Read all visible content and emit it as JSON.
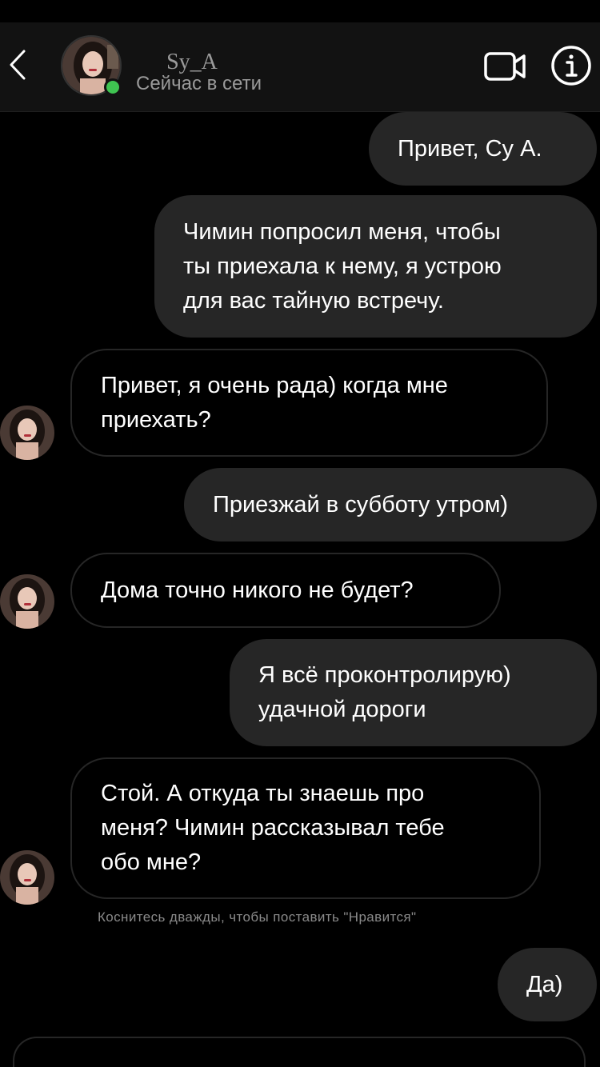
{
  "header": {
    "name": "Sy_A",
    "status": "Сейчас в сети",
    "back_icon": "chevron-left-icon",
    "video_icon": "video-camera-icon",
    "info_icon": "info-icon",
    "online_color": "#3fc451"
  },
  "messages": [
    {
      "from": "me",
      "text": "Привет, Су А."
    },
    {
      "from": "me",
      "text": "Чимин попросил меня, чтобы\nты приехала к нему, я устрою\nдля вас тайную встречу."
    },
    {
      "from": "them",
      "text": "Привет, я очень рада) когда мне\nприехать?"
    },
    {
      "from": "me",
      "text": "Приезжай в субботу утром)"
    },
    {
      "from": "them",
      "text": "Дома точно никого не будет?"
    },
    {
      "from": "me",
      "text": "Я всё проконтролирую)\nудачной дороги"
    },
    {
      "from": "them",
      "text": "Стой. А откуда ты знаешь про\nменя? Чимин рассказывал тебе\nобо мне?"
    },
    {
      "from": "me",
      "text": "Да)"
    }
  ],
  "hint": "Коснитесь дважды, чтобы поставить \"Нравится\"",
  "colors": {
    "background": "#000000",
    "outgoing_bubble": "#262626",
    "incoming_border": "#262626",
    "secondary_text": "#9a9a9a"
  }
}
